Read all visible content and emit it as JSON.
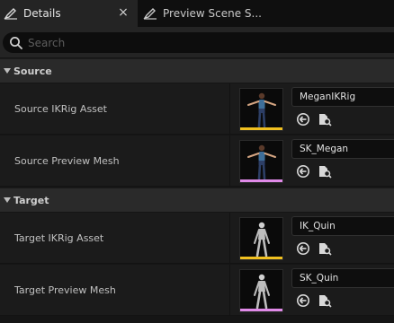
{
  "tabs": [
    {
      "label": "Details",
      "icon": "details-icon",
      "active": true
    },
    {
      "label": "Preview Scene S...",
      "icon": "preview-scene-icon",
      "active": false
    }
  ],
  "tab_close": "×",
  "search": {
    "placeholder": "Search",
    "value": ""
  },
  "categories": [
    {
      "label": "Source",
      "rows": [
        {
          "label": "Source IKRig Asset",
          "value": "MeganIKRig",
          "thumb_bar_color": "#f0c020",
          "thumb_character": "megan"
        },
        {
          "label": "Source Preview Mesh",
          "value": "SK_Megan",
          "thumb_bar_color": "#e08ae8",
          "thumb_character": "megan"
        }
      ]
    },
    {
      "label": "Target",
      "rows": [
        {
          "label": "Target IKRig Asset",
          "value": "IK_Quin",
          "thumb_bar_color": "#f0c020",
          "thumb_character": "quin"
        },
        {
          "label": "Target Preview Mesh",
          "value": "SK_Quin",
          "thumb_bar_color": "#e08ae8",
          "thumb_character": "quin"
        }
      ]
    }
  ],
  "row_actions": [
    {
      "icon": "use-selected-asset-arrow-icon"
    },
    {
      "icon": "browse-to-asset-icon"
    }
  ]
}
